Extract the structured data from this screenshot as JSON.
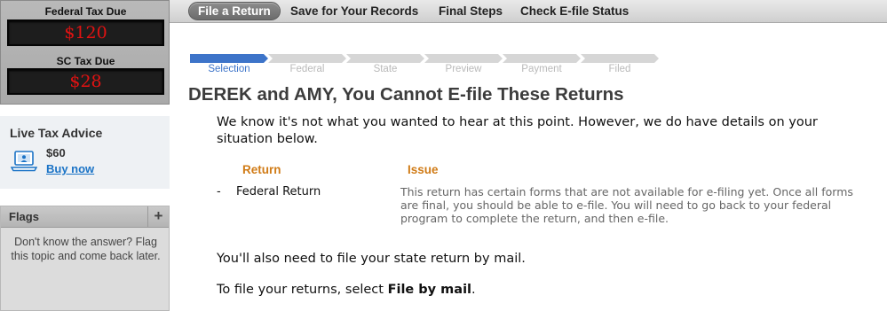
{
  "sidebar": {
    "federal_label": "Federal Tax Due",
    "federal_amount": "$120",
    "state_label": "SC Tax Due",
    "state_amount": "$28",
    "advice": {
      "title": "Live Tax Advice",
      "price": "$60",
      "buy_label": "Buy now",
      "icon": "laptop-advisor-icon"
    },
    "flags": {
      "title": "Flags",
      "add_icon": "plus-icon",
      "add_label": "+",
      "help_text": "Don't know the answer? Flag this topic and come back later."
    }
  },
  "nav": {
    "items": [
      {
        "label": "File a Return",
        "active": true
      },
      {
        "label": "Save for Your Records",
        "active": false
      },
      {
        "label": "Final Steps",
        "active": false
      },
      {
        "label": "Check E-file Status",
        "active": false
      }
    ]
  },
  "progress": {
    "steps": [
      "Selection",
      "Federal",
      "State",
      "Preview",
      "Payment",
      "Filed"
    ],
    "completed_steps": 1,
    "complete_color": "#3d74c9",
    "pending_color": "#d6d6d6"
  },
  "main": {
    "headline": "DEREK and AMY, You Cannot E-file These Returns",
    "intro": "We know it's not what you wanted to hear at this point. However, we do have details on your situation below.",
    "table": {
      "col_return": "Return",
      "col_issue": "Issue",
      "rows": [
        {
          "bullet": "-",
          "return": "Federal Return",
          "issue": "This return has certain forms that are not available for e-filing yet. Once all forms are final, you should be able to e-file. You will need to go back to your federal program to complete the return, and then e-file."
        }
      ]
    },
    "state_mail_text": "You'll also need to file your state return by mail.",
    "instruction_prefix": "To file your returns, select ",
    "instruction_action": "File by mail",
    "instruction_suffix": "."
  },
  "colors": {
    "accent_blue": "#3d74c9",
    "header_orange": "#d07b16",
    "tax_due_red": "#e21212",
    "link_blue": "#1a73c6"
  }
}
